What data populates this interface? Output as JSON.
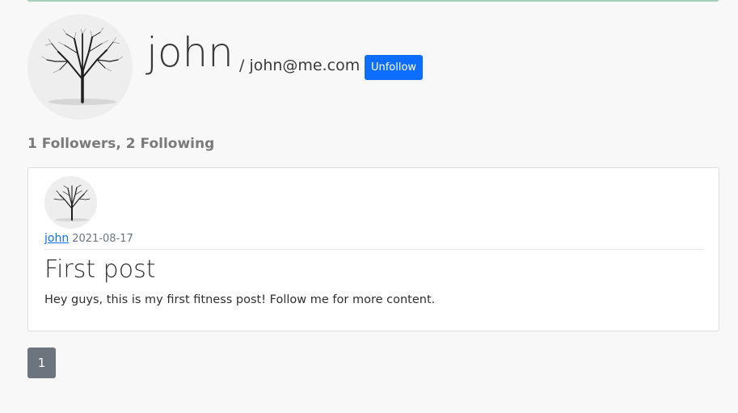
{
  "profile": {
    "username": "john",
    "email": "/ john@me.com",
    "unfollow_label": "Unfollow",
    "stats": "1 Followers, 2 Following",
    "avatar_icon": "tree-avatar-icon"
  },
  "posts": [
    {
      "author": "john",
      "date": "2021-08-17",
      "title": "First post",
      "body": "Hey guys, this is my first fitness post! Follow me for more content."
    }
  ],
  "pagination": {
    "current": "1"
  },
  "colors": {
    "primary": "#0d6efd",
    "secondary": "#6c757d",
    "top_bar": "#a3cfbb"
  }
}
